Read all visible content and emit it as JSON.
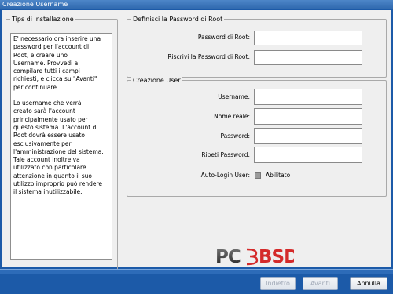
{
  "window": {
    "title": "Creazione Username"
  },
  "tips": {
    "legend": "Tips di installazione",
    "paragraph1": "E' necessario ora inserire una\npassword per l'account di\nRoot, e creare uno\nUsername. Provvedi a\ncompilare tutti i campi\nrichiesti, e clicca su \"Avanti\"\nper continuare.",
    "paragraph2": "Lo username che verrà\ncreato sarà l'account\nprincipalmente usato per\nquesto sistema. L'account di\nRoot dovrà essere usato\nesclusivamente per\nl'amministrazione del sistema.\nTale account inoltre va\nutilizzato con particolare\nattenzione in quanto il suo\nutilizzo improprio può rendere\nil sistema inutilizzabile."
  },
  "root_password": {
    "legend": "Definisci la Password di Root",
    "password_label": "Password di Root:",
    "password_value": "",
    "confirm_label": "Riscrivi la Password di Root:",
    "confirm_value": ""
  },
  "user": {
    "legend": "Creazione User",
    "username_label": "Username:",
    "username_value": "",
    "realname_label": "Nome reale:",
    "realname_value": "",
    "password_label": "Password:",
    "password_value": "",
    "repeat_label": "Ripeti Password:",
    "repeat_value": "",
    "autologin_label": "Auto-Login User:",
    "autologin_option": "Abilitato"
  },
  "logo": {
    "text_left": "PC",
    "text_right": "BSD",
    "primary_color": "#333333",
    "accent_color": "#d42a2a"
  },
  "buttons": {
    "back": "Indietro",
    "next": "Avanti",
    "cancel": "Annulla"
  },
  "colors": {
    "frame": "#1c5aa8",
    "panel": "#efefef"
  }
}
